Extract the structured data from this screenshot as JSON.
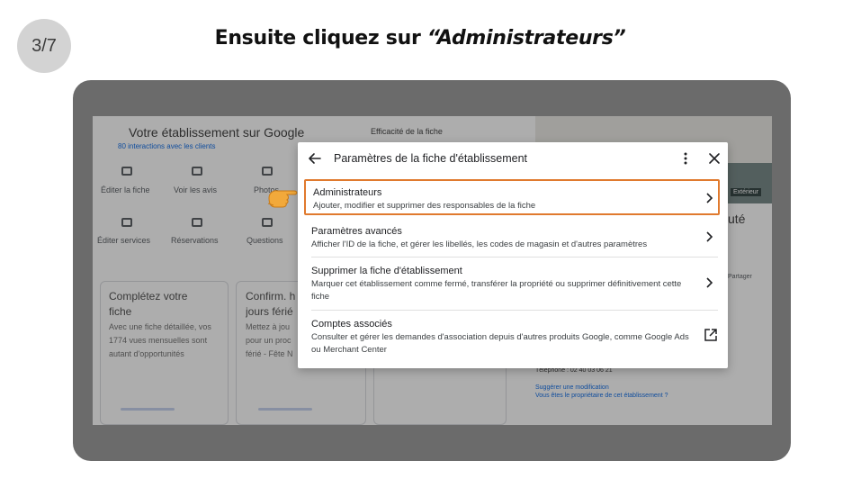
{
  "step": {
    "label": "3/7"
  },
  "heading": {
    "prefix": "Ensuite cliquez sur ",
    "emphasis": "“Administrateurs”"
  },
  "background_app": {
    "title": "Votre établissement sur Google",
    "interactions": "80 interactions avec les clients",
    "efficiency_label": "Efficacité de la fiche",
    "actions": [
      {
        "label": "Éditer la fiche",
        "icon": "storefront-icon"
      },
      {
        "label": "Voir les avis",
        "icon": "reviews-icon"
      },
      {
        "label": "Photos",
        "icon": "photo-icon"
      },
      {
        "label": "Éditer services",
        "icon": "list-icon"
      },
      {
        "label": "Réservations",
        "icon": "calendar-icon"
      },
      {
        "label": "Questions",
        "icon": "chat-icon"
      }
    ],
    "cards": [
      {
        "title": "Complétez votre fiche",
        "text": "Avec une fiche détaillée, vos 1774 vues mensuelles sont autant d'opportunités"
      },
      {
        "title": "Confirm. h jours férié",
        "text": "Mettez à jou pour un proc férié - Fête N"
      }
    ],
    "photo_badge": "Extérieur",
    "side_word": "uté",
    "share_label": "Partager",
    "phone": "Téléphone : 02 40 03 06 21",
    "suggest_link": "Suggérer une modification",
    "owner_link": "Vous êtes le propriétaire de cet établissement ?"
  },
  "dialog": {
    "title": "Paramètres de la fiche d'établissement",
    "items": [
      {
        "title": "Administrateurs",
        "desc": "Ajouter, modifier et supprimer des responsables de la fiche",
        "highlighted": true,
        "icon": "chevron-right-icon"
      },
      {
        "title": "Paramètres avancés",
        "desc": "Afficher l'ID de la fiche, et gérer les libellés, les codes de magasin et d'autres paramètres",
        "highlighted": false,
        "icon": "chevron-right-icon"
      },
      {
        "title": "Supprimer la fiche d'établissement",
        "desc": "Marquer cet établissement comme fermé, transférer la propriété ou supprimer définitivement cette fiche",
        "highlighted": false,
        "icon": "chevron-right-icon"
      },
      {
        "title": "Comptes associés",
        "desc": "Consulter et gérer les demandes d'association depuis d'autres produits Google, comme Google Ads ou Merchant Center",
        "highlighted": false,
        "icon": "open-in-new-icon"
      }
    ]
  },
  "colors": {
    "highlight": "#e07a2e",
    "frame": "#6b6b6b",
    "badge": "#d3d3d3"
  }
}
